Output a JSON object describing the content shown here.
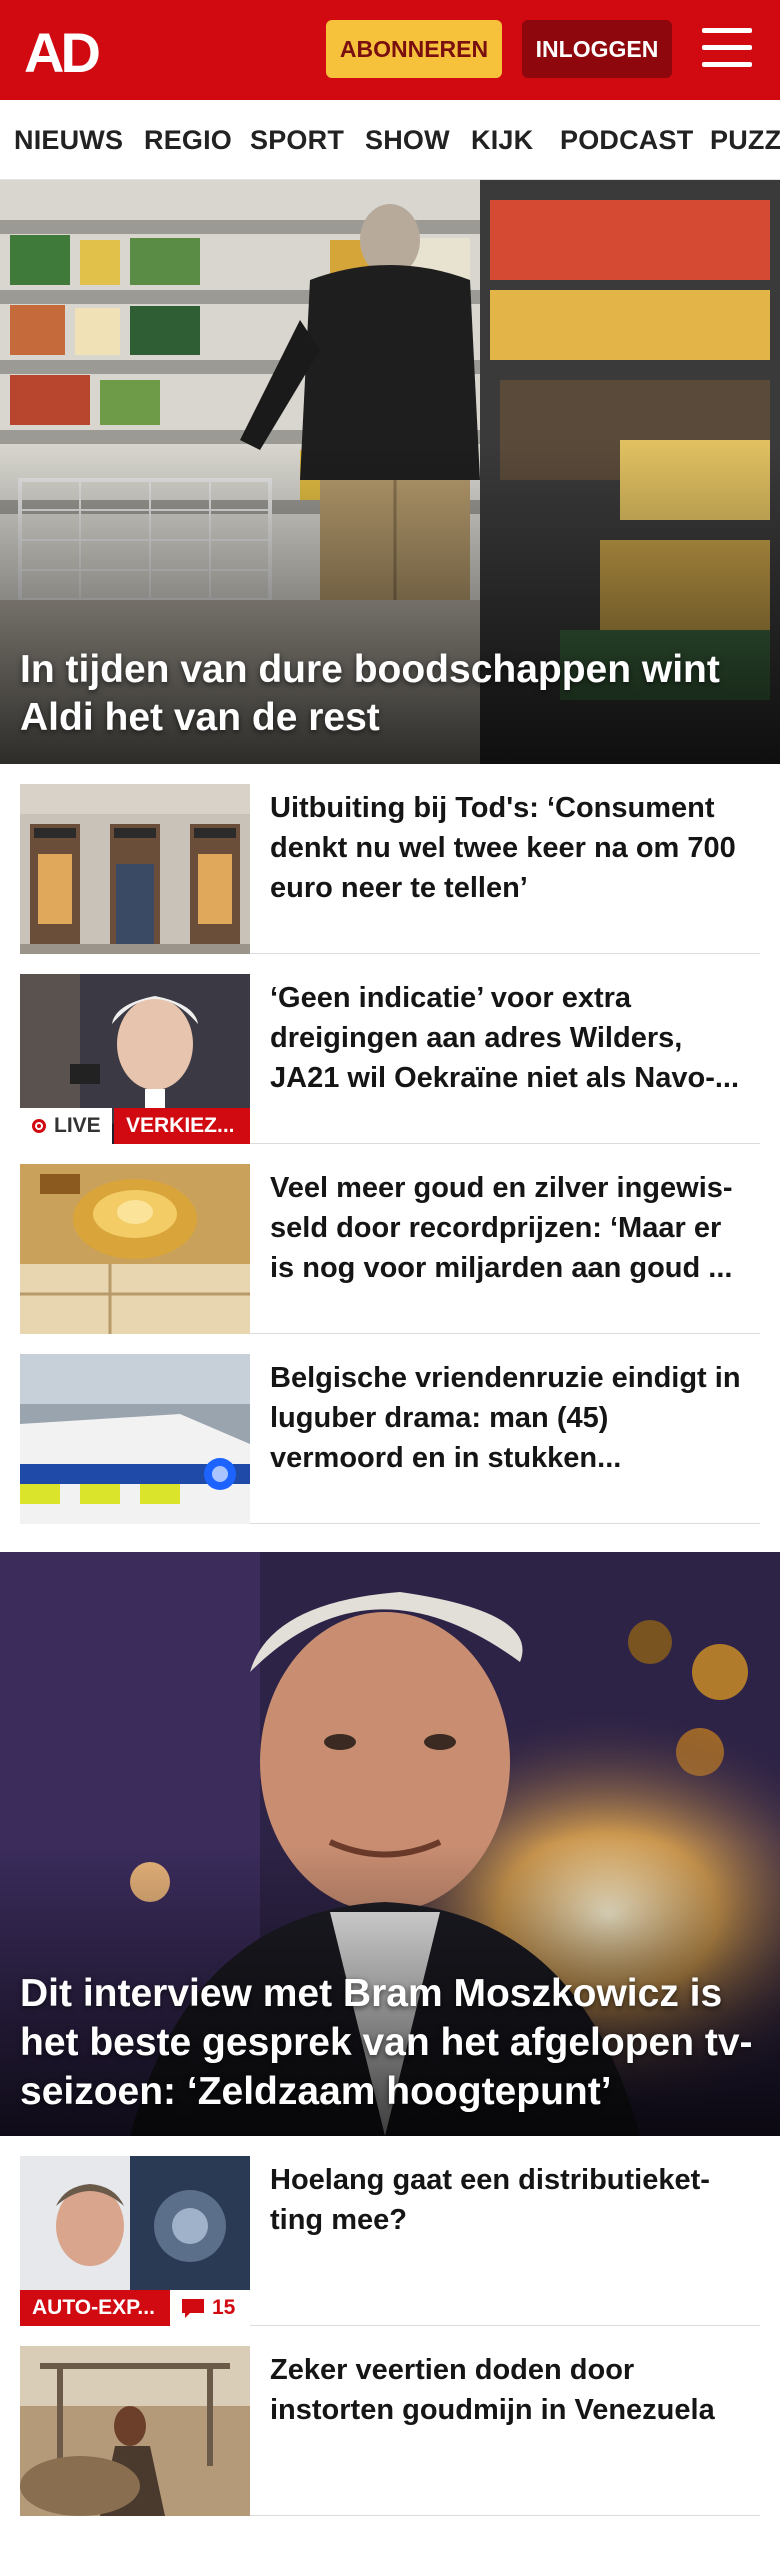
{
  "header": {
    "logo": "AD",
    "subscribe_label": "ABONNEREN",
    "login_label": "INLOGGEN",
    "menu_icon": "hamburger-menu-icon",
    "brand_color": "#d10a11",
    "accent_color": "#f6c23c"
  },
  "nav": {
    "items": [
      {
        "label": "NIEUWS"
      },
      {
        "label": "REGIO"
      },
      {
        "label": "SPORT"
      },
      {
        "label": "SHOW"
      },
      {
        "label": "KIJK"
      },
      {
        "label": "PODCAST"
      },
      {
        "label": "PUZZ"
      }
    ]
  },
  "hero1": {
    "title": "In tijden van dure boodschappen wint Aldi het van de rest"
  },
  "articles": [
    {
      "title": "Uitbuiting bij Tod's: ‘Consument denkt nu wel twee keer na om 700 euro neer te tellen’"
    },
    {
      "title": "‘Geen indicatie’ voor extra dreigingen aan adres Wilders, JA21 wil Oekraïne niet als Navo-...",
      "live_label": "LIVE",
      "tag": "VERKIEZ..."
    },
    {
      "title": "Veel meer goud en zilver ingewis­seld door recordprijzen: ‘Maar er is nog voor miljarden aan goud ..."
    },
    {
      "title": "Belgische vriendenruzie eindigt in luguber drama: man (45) vermoord en in stukken..."
    }
  ],
  "hero2": {
    "title": "Dit interview met Bram Moszkowicz is het beste gesprek van het afgelopen tv-seizoen: ‘Zeldzaam hoogtepunt’"
  },
  "articles2": [
    {
      "title": "Hoelang gaat een distributieket­ting mee?",
      "tag": "AUTO-EXP...",
      "comments": "15",
      "comment_icon": "comment-bubble-icon"
    },
    {
      "title": "Zeker veertien doden door instorten goudmijn in Venezuela"
    }
  ]
}
